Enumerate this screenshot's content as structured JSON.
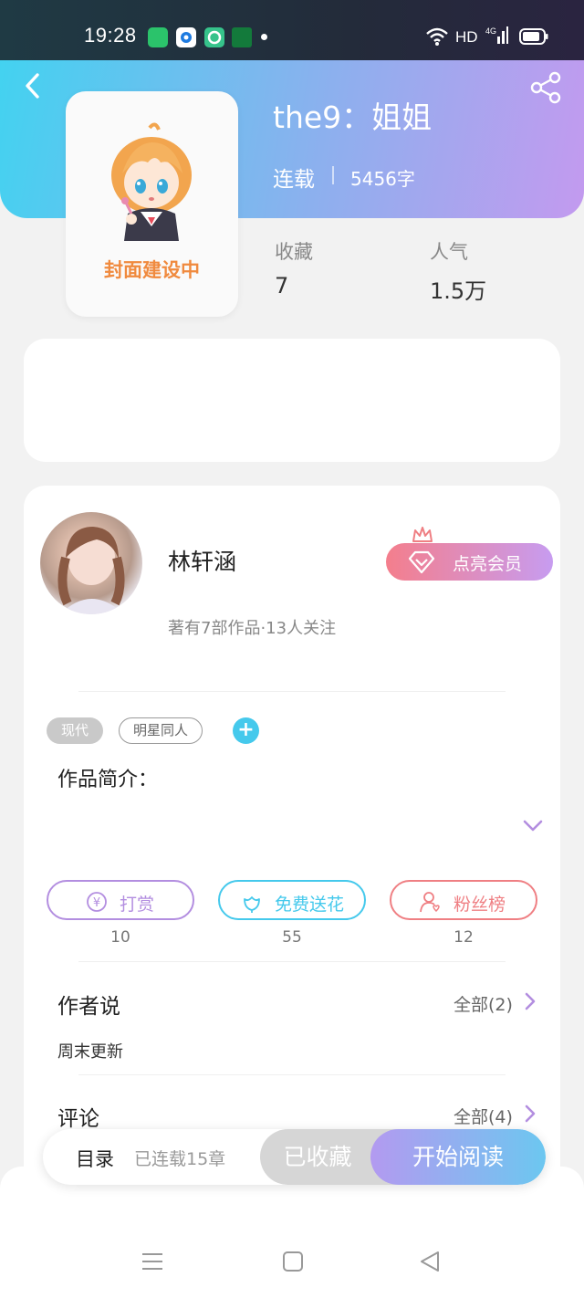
{
  "status_bar": {
    "time": "19:28",
    "network_label": "HD",
    "notifications": [
      "app-notification-icon",
      "browser-notification-icon",
      "chat-notification-icon",
      "oppo-notification-icon"
    ]
  },
  "book": {
    "title": "the9：姐姐",
    "status": "连载",
    "word_count": "5456字",
    "cover_placeholder_text": "封面建设中",
    "stats": [
      {
        "label": "收藏",
        "value": "7"
      },
      {
        "label": "人气",
        "value": "1.5万"
      }
    ]
  },
  "author": {
    "name": "林轩涵",
    "meta": "著有7部作品·13人关注",
    "vip_button_label": "点亮会员"
  },
  "tags": [
    {
      "label": "现代",
      "style": "filled"
    },
    {
      "label": "明星同人",
      "style": "outline"
    }
  ],
  "intro": {
    "label": "作品简介："
  },
  "actions": [
    {
      "label": "打赏",
      "count": "10",
      "color": "#b38ee0",
      "icon": "yen-coin-icon"
    },
    {
      "label": "免费送花",
      "count": "55",
      "color": "#45c9ec",
      "icon": "flower-icon"
    },
    {
      "label": "粉丝榜",
      "count": "12",
      "color": "#ef7f83",
      "icon": "fan-user-icon"
    }
  ],
  "author_says": {
    "title": "作者说",
    "more": "全部(2)",
    "content": "周末更新"
  },
  "comments": {
    "title": "评论",
    "more": "全部(4)"
  },
  "bottom_bar": {
    "toc_label": "目录",
    "chapter_count": "已连载15章",
    "collected_label": "已收藏",
    "read_label": "开始阅读"
  },
  "colors": {
    "header_gradient_start": "#43d2f0",
    "header_gradient_end": "#c39aef",
    "accent_blue": "#45c9ec",
    "accent_purple": "#b38ee0",
    "accent_red": "#ef7f83"
  }
}
